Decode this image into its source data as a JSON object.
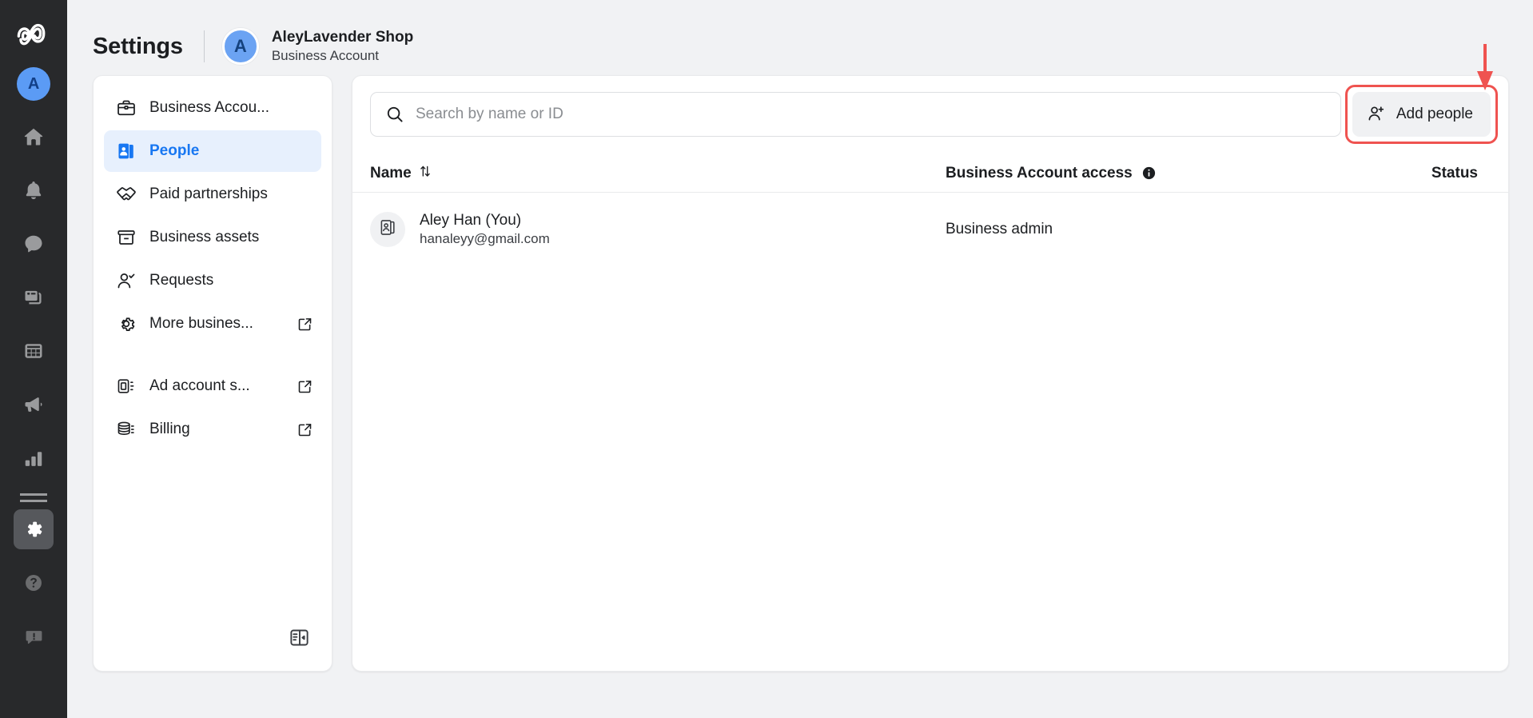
{
  "rail": {
    "logo_icon": "meta-infinity-logo",
    "avatar_initial": "A",
    "items": [
      {
        "name": "home",
        "icon": "home-icon",
        "active": false
      },
      {
        "name": "notifications",
        "icon": "bell-icon",
        "active": false
      },
      {
        "name": "messages",
        "icon": "chat-bubble-icon",
        "active": false
      },
      {
        "name": "content",
        "icon": "cards-stack-icon",
        "active": false
      },
      {
        "name": "planner",
        "icon": "grid-calendar-icon",
        "active": false
      },
      {
        "name": "ads",
        "icon": "megaphone-icon",
        "active": false
      },
      {
        "name": "insights",
        "icon": "bar-chart-icon",
        "active": false
      },
      {
        "name": "all-tools",
        "icon": "menu-lines-icon",
        "active": false
      },
      {
        "name": "settings",
        "icon": "gear-icon",
        "active": true
      },
      {
        "name": "help",
        "icon": "question-circle-icon",
        "active": false
      },
      {
        "name": "feedback",
        "icon": "exclamation-bubble-icon",
        "active": false
      }
    ]
  },
  "header": {
    "title": "Settings",
    "account_initial": "A",
    "account_name": "AleyLavender Shop",
    "account_type": "Business Account"
  },
  "nav": {
    "items": [
      {
        "label": "Business Accou...",
        "icon": "briefcase-icon",
        "active": false,
        "external": false
      },
      {
        "label": "People",
        "icon": "id-badge-icon",
        "active": true,
        "external": false
      },
      {
        "label": "Paid partnerships",
        "icon": "handshake-icon",
        "active": false,
        "external": false
      },
      {
        "label": "Business assets",
        "icon": "archive-box-icon",
        "active": false,
        "external": false
      },
      {
        "label": "Requests",
        "icon": "person-check-icon",
        "active": false,
        "external": false
      },
      {
        "label": "More busines...",
        "icon": "gear-icon",
        "active": false,
        "external": true
      }
    ],
    "items_secondary": [
      {
        "label": "Ad account s...",
        "icon": "ad-account-icon",
        "active": false,
        "external": true
      },
      {
        "label": "Billing",
        "icon": "coins-stack-icon",
        "active": false,
        "external": true
      }
    ],
    "collapse_icon": "panel-collapse-icon"
  },
  "toolbar": {
    "search_placeholder": "Search by name or ID",
    "search_value": "",
    "search_icon": "search-icon",
    "add_people_label": "Add people",
    "add_people_icon": "person-plus-icon",
    "highlight_color": "#ef5350"
  },
  "table": {
    "columns": [
      {
        "key": "name",
        "label": "Name",
        "sort_icon": "sort-arrows-icon"
      },
      {
        "key": "access",
        "label": "Business Account access",
        "info_icon": "info-circle-icon"
      },
      {
        "key": "status",
        "label": "Status"
      }
    ],
    "rows": [
      {
        "avatar_icon": "id-card-icon",
        "name": "Aley Han (You)",
        "email": "hanaleyy@gmail.com",
        "access": "Business admin",
        "status": ""
      }
    ]
  },
  "annotation": {
    "arrow_icon": "down-arrow-annotation",
    "color": "#ef5350"
  }
}
